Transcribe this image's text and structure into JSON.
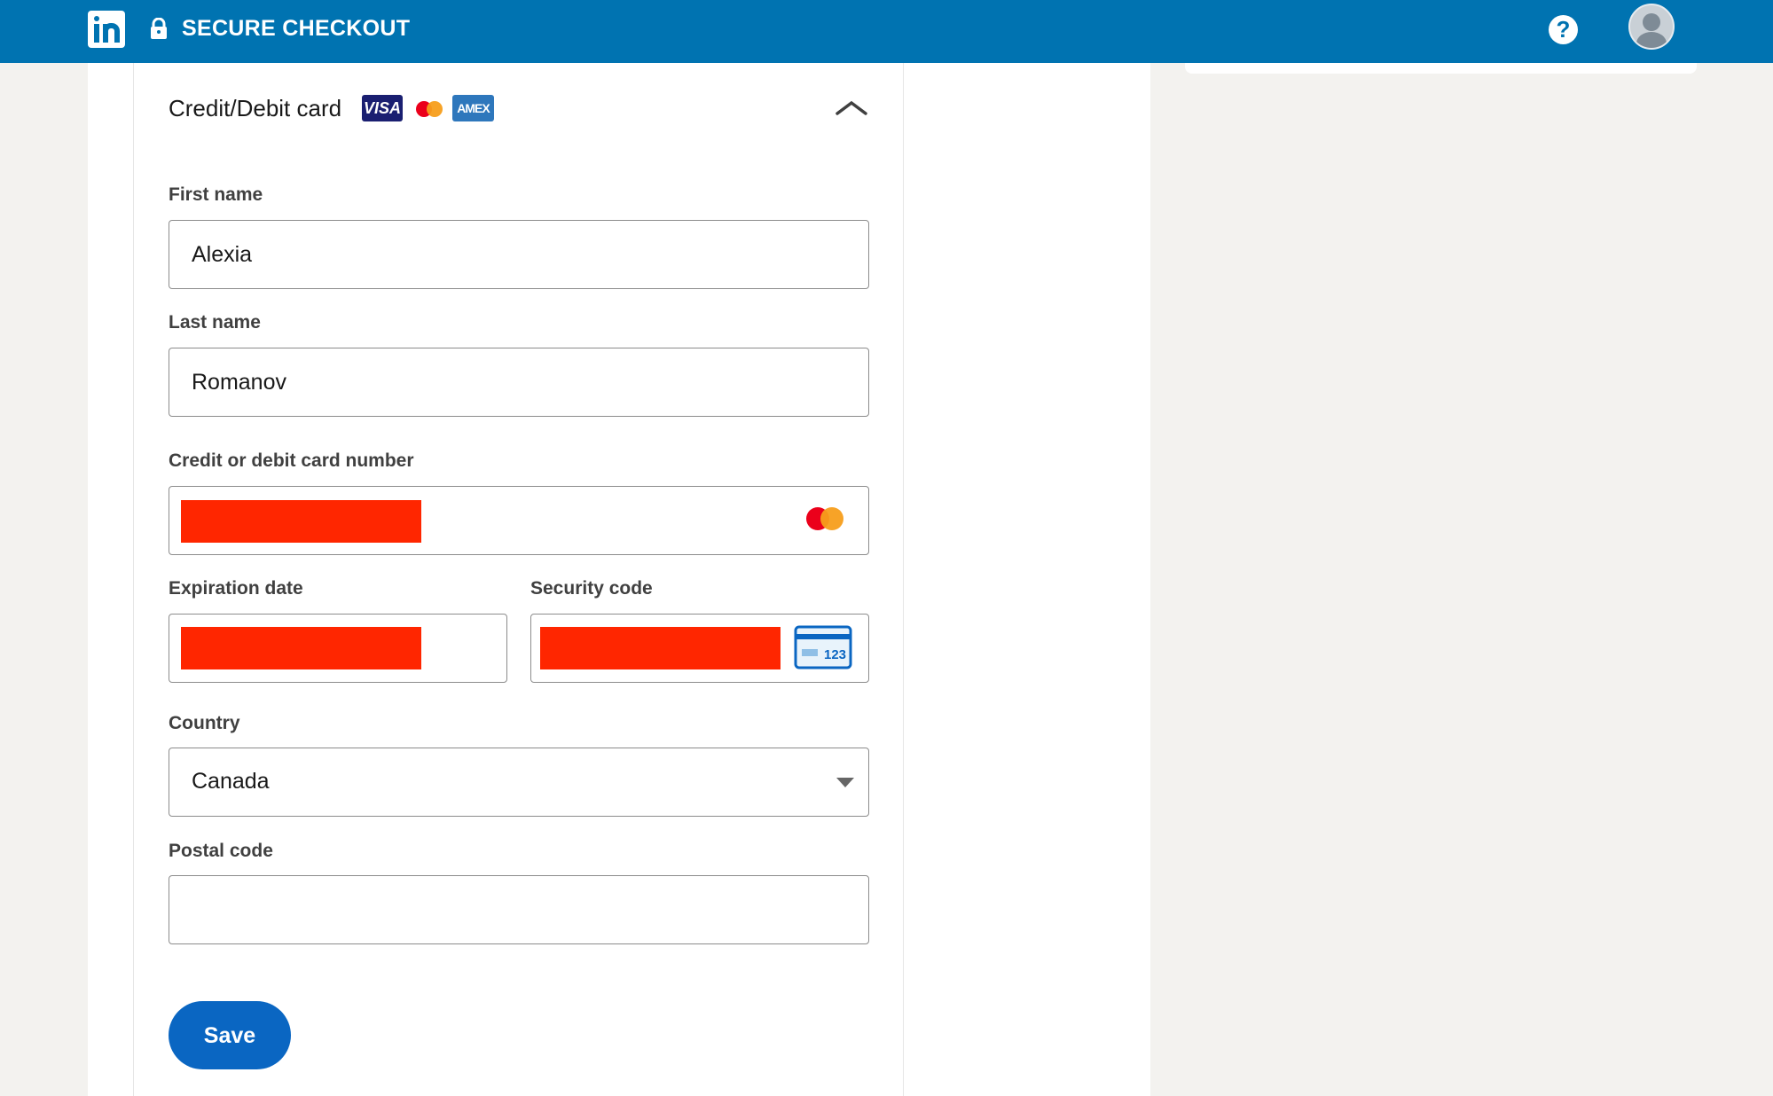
{
  "header": {
    "logo_icon": "linkedin-logo-icon",
    "lock_icon": "lock-icon",
    "title": "SECURE CHECKOUT",
    "help_label": "?",
    "help_icon": "help-icon",
    "avatar_icon": "avatar-icon",
    "bar_color": "#0073b1"
  },
  "payment": {
    "method_title": "Credit/Debit card",
    "card_logos": {
      "visa": "VISA",
      "amex": "AMEX",
      "mastercard_icon": "mastercard-icon"
    },
    "collapse_icon": "chevron-up-icon"
  },
  "form": {
    "first_name": {
      "label": "First name",
      "value": "Alexia"
    },
    "last_name": {
      "label": "Last name",
      "value": "Romanov"
    },
    "card_number": {
      "label": "Credit or debit card number",
      "brand_icon": "mastercard-icon",
      "redacted": true
    },
    "expiration": {
      "label": "Expiration date",
      "redacted": true
    },
    "security_code": {
      "label": "Security code",
      "icon": "card-cvv-icon",
      "icon_text": "123",
      "redacted": true
    },
    "country": {
      "label": "Country",
      "value": "Canada",
      "caret_icon": "caret-down-icon"
    },
    "postal_code": {
      "label": "Postal code",
      "value": ""
    },
    "save_label": "Save",
    "accent_color": "#0a66c2",
    "redaction_color": "#ff2600"
  }
}
